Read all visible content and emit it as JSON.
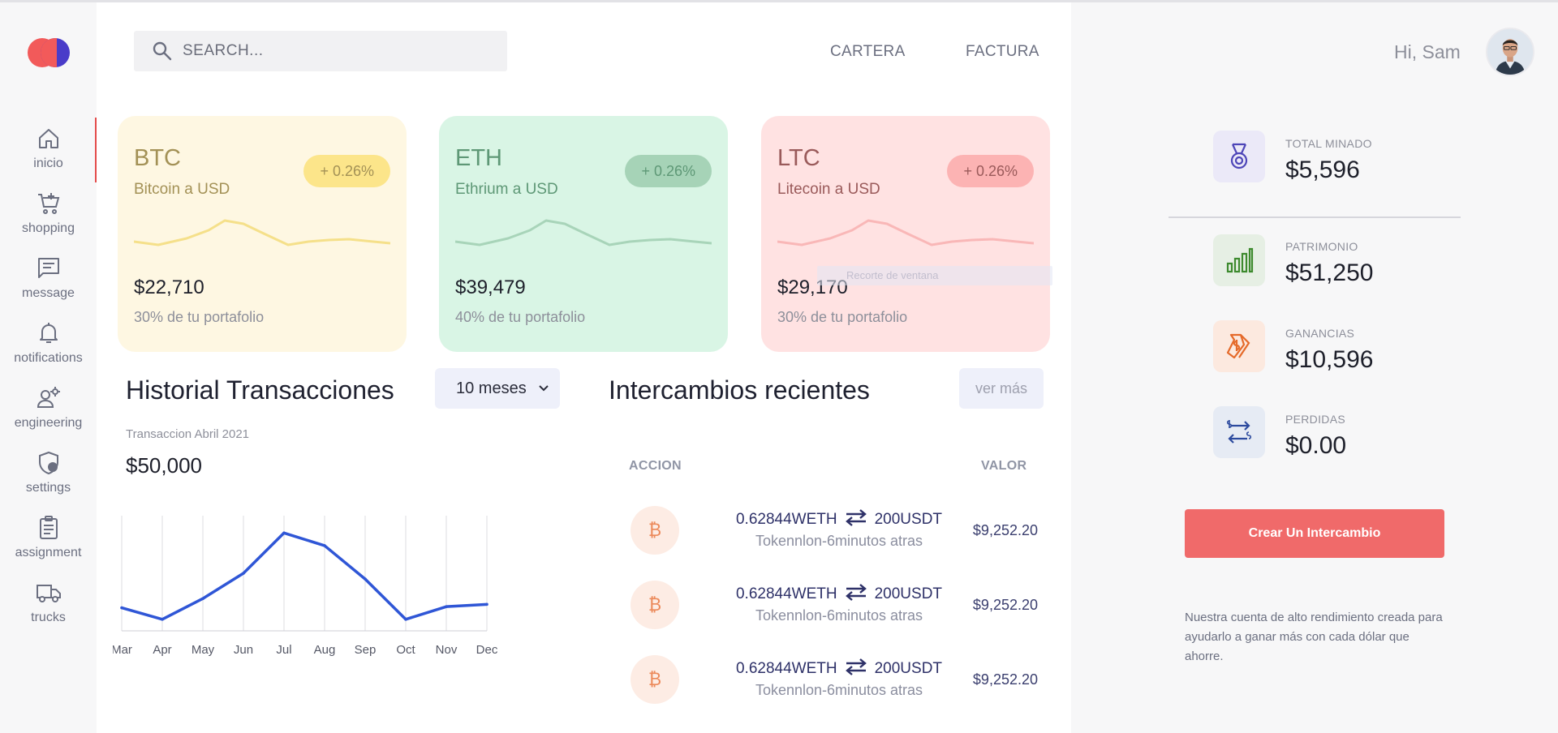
{
  "sidebar": {
    "items": [
      {
        "label": "inicio",
        "icon": "home-icon"
      },
      {
        "label": "shopping",
        "icon": "cart-icon"
      },
      {
        "label": "message",
        "icon": "message-icon"
      },
      {
        "label": "notifications",
        "icon": "bell-icon"
      },
      {
        "label": "engineering",
        "icon": "engineering-icon"
      },
      {
        "label": "settings",
        "icon": "shield-user-icon"
      },
      {
        "label": "assignment",
        "icon": "clipboard-icon"
      },
      {
        "label": "trucks",
        "icon": "truck-icon"
      }
    ],
    "active_index": 0
  },
  "search": {
    "placeholder": "SEARCH..."
  },
  "topnav": {
    "cartera": "CARTERA",
    "factura": "FACTURA"
  },
  "cards": [
    {
      "symbol": "BTC",
      "pair": "Bitcoin a USD",
      "change": "+ 0.26%",
      "price": "$22,710",
      "portfolio": "30% de tu portafolio",
      "bg": "#fef7e2",
      "accent": "#a39156",
      "badge": "#fce58a",
      "line": "#f5e08a"
    },
    {
      "symbol": "ETH",
      "pair": "Ethrium a USD",
      "change": "+ 0.26%",
      "price": "$39,479",
      "portfolio": "40% de tu portafolio",
      "bg": "#d9f5e5",
      "accent": "#5e9876",
      "badge": "#a6d3b7",
      "line": "#a8d4b9"
    },
    {
      "symbol": "LTC",
      "pair": "Litecoin a USD",
      "change": "+ 0.26%",
      "price": "$29,170",
      "portfolio": "30% de tu portafolio",
      "bg": "#ffe2e2",
      "accent": "#9a5a5a",
      "badge": "#fcb3b3",
      "line": "#f9b7b7"
    }
  ],
  "history": {
    "title": "Historial Transacciones",
    "range": "10 meses",
    "subtitle": "Transaccion Abril 2021",
    "amount": "$50,000"
  },
  "chart_data": {
    "type": "line",
    "categories": [
      "Mar",
      "Apr",
      "May",
      "Jun",
      "Jul",
      "Aug",
      "Sep",
      "Oct",
      "Nov",
      "Dec"
    ],
    "series": [
      {
        "values": [
          20,
          10,
          28,
          50,
          85,
          74,
          45,
          10,
          21,
          23
        ]
      }
    ],
    "ylim": [
      0,
      100
    ],
    "grid": "vertical",
    "color": "#2f56d6"
  },
  "recent": {
    "title": "Intercambios recientes",
    "more": "ver más",
    "col_action": "ACCION",
    "col_value": "VALOR",
    "rows": [
      {
        "from": "0.62844WETH",
        "to": "200USDT",
        "sub": "Tokennlon-6minutos atras",
        "value": "$9,252.20",
        "coin": "₿"
      },
      {
        "from": "0.62844WETH",
        "to": "200USDT",
        "sub": "Tokennlon-6minutos atras",
        "value": "$9,252.20",
        "coin": "₿"
      },
      {
        "from": "0.62844WETH",
        "to": "200USDT",
        "sub": "Tokennlon-6minutos atras",
        "value": "$9,252.20",
        "coin": "₿"
      }
    ]
  },
  "ghost_text": "Recorte de ventana",
  "right": {
    "greeting": "Hi, Sam",
    "stats": [
      {
        "label": "TOTAL MINADO",
        "value": "$5,596",
        "icon": "medal-icon",
        "bg": "#ebe9f8",
        "color": "#4d45b8"
      },
      {
        "label": "PATRIMONIO",
        "value": "$51,250",
        "icon": "bar-chart-icon",
        "bg": "#e6efe4",
        "color": "#3d8a2e"
      },
      {
        "label": "GANANCIAS",
        "value": "$10,596",
        "icon": "money-tag-icon",
        "bg": "#fce9df",
        "color": "#e56a2a"
      },
      {
        "label": "PERDIDAS",
        "value": "$0.00",
        "icon": "exchange-icon",
        "bg": "#e6ebf4",
        "color": "#2c4a9e"
      }
    ],
    "cta": "Crear Un Intercambio",
    "note": "Nuestra cuenta de alto rendimiento creada para ayudarlo a ganar más con cada dólar que ahorre."
  }
}
